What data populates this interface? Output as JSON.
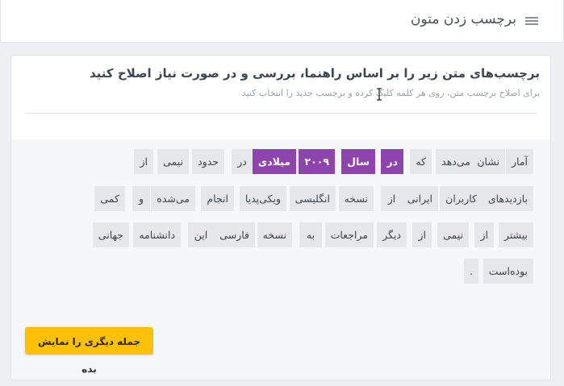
{
  "header": {
    "title": "برچسب زدن متون",
    "menu_icon": "hamburger-menu-icon"
  },
  "card": {
    "heading": "برچسب‌های متن زیر را بر اساس راهنما، بررسی و در صورت نیاز اصلاح کنید",
    "subtext": "برای اصلاح برچسب متن، روی هر کلمه کلیک کرده و برچسب جدید را انتخاب کنید",
    "cursor_icon": "text-cursor-icon"
  },
  "tags": [
    {
      "text": "آمار",
      "selected": false
    },
    {
      "text": "نشان",
      "selected": false
    },
    {
      "text": "می‌دهد",
      "selected": false
    },
    {
      "text": "که",
      "selected": false
    },
    {
      "text": "در",
      "selected": true
    },
    {
      "text": "سال",
      "selected": true
    },
    {
      "text": "۲۰۰۹",
      "selected": true
    },
    {
      "text": "میلادی",
      "selected": true
    },
    {
      "text": "در",
      "selected": false
    },
    {
      "text": "حدود",
      "selected": false
    },
    {
      "text": "نیمی",
      "selected": false
    },
    {
      "text": "از",
      "selected": false
    },
    {
      "text": "بازدیدهای",
      "selected": false
    },
    {
      "text": "کاربران",
      "selected": false
    },
    {
      "text": "ایرانی",
      "selected": false
    },
    {
      "text": "از",
      "selected": false
    },
    {
      "text": "نسخه",
      "selected": false
    },
    {
      "text": "انگلیسی",
      "selected": false
    },
    {
      "text": "ویکی‌پدیا",
      "selected": false
    },
    {
      "text": "انجام",
      "selected": false
    },
    {
      "text": "می‌شده",
      "selected": false
    },
    {
      "text": "و",
      "selected": false
    },
    {
      "text": "کمی",
      "selected": false
    },
    {
      "text": "بیشتر",
      "selected": false
    },
    {
      "text": "از",
      "selected": false
    },
    {
      "text": "نیمی",
      "selected": false
    },
    {
      "text": "از",
      "selected": false
    },
    {
      "text": "دیگر",
      "selected": false
    },
    {
      "text": "مراجعات",
      "selected": false
    },
    {
      "text": "به",
      "selected": false
    },
    {
      "text": "نسخه",
      "selected": false
    },
    {
      "text": "فارسی",
      "selected": false
    },
    {
      "text": "این",
      "selected": false
    },
    {
      "text": "دانشنامه",
      "selected": false
    },
    {
      "text": "جهانی",
      "selected": false
    },
    {
      "text": "بوده‌است",
      "selected": false
    },
    {
      "text": ".",
      "selected": false
    }
  ],
  "cta_label": "جمله دیگری را نمایش بده",
  "colors": {
    "selected_tag": "#8e44ad",
    "tag_bg": "#e6e7ea",
    "cta": "#ffc107"
  }
}
